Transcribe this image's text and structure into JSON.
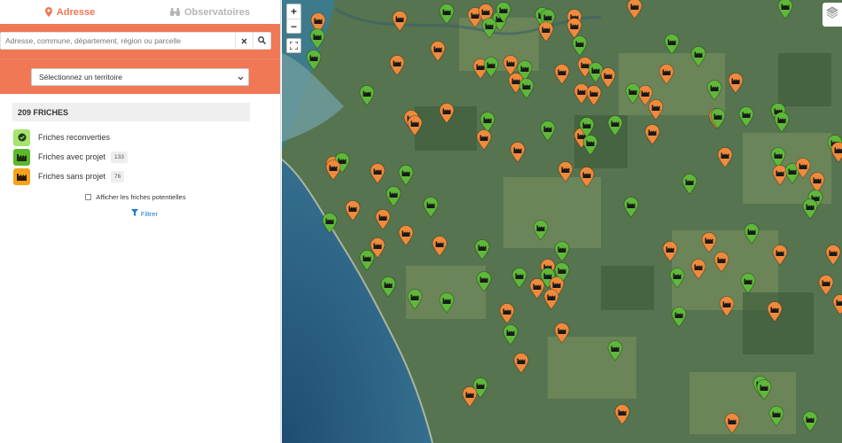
{
  "tabs": [
    {
      "label": "Adresse",
      "icon": "map-pin-icon",
      "active": true
    },
    {
      "label": "Observatoires",
      "icon": "binoculars-icon",
      "active": false
    }
  ],
  "search": {
    "placeholder": "Adresse, commune, département, région ou parcelle"
  },
  "territory": {
    "selected": "Sélectionnez un territoire"
  },
  "summary": {
    "count_label": "209 FRICHES"
  },
  "legend": [
    {
      "label": "Friches reconverties",
      "color": "#7fd64b",
      "icon": "check-circle-icon",
      "count": ""
    },
    {
      "label": "Friches avec projet",
      "color": "#5cb82b",
      "icon": "factory-icon",
      "count": "133"
    },
    {
      "label": "Friches sans projet",
      "color": "#f5a21b",
      "icon": "factory-icon",
      "count": "76"
    }
  ],
  "potential": {
    "label": "Afficher les friches potentielles",
    "checked": false
  },
  "filter": {
    "label": "Filtrer",
    "icon": "funnel-icon"
  },
  "map": {
    "zoom_in": "+",
    "zoom_out": "−",
    "colors": {
      "project": "#5fb83a",
      "no_project": "#f08a3c",
      "accent": "#f07855"
    }
  }
}
